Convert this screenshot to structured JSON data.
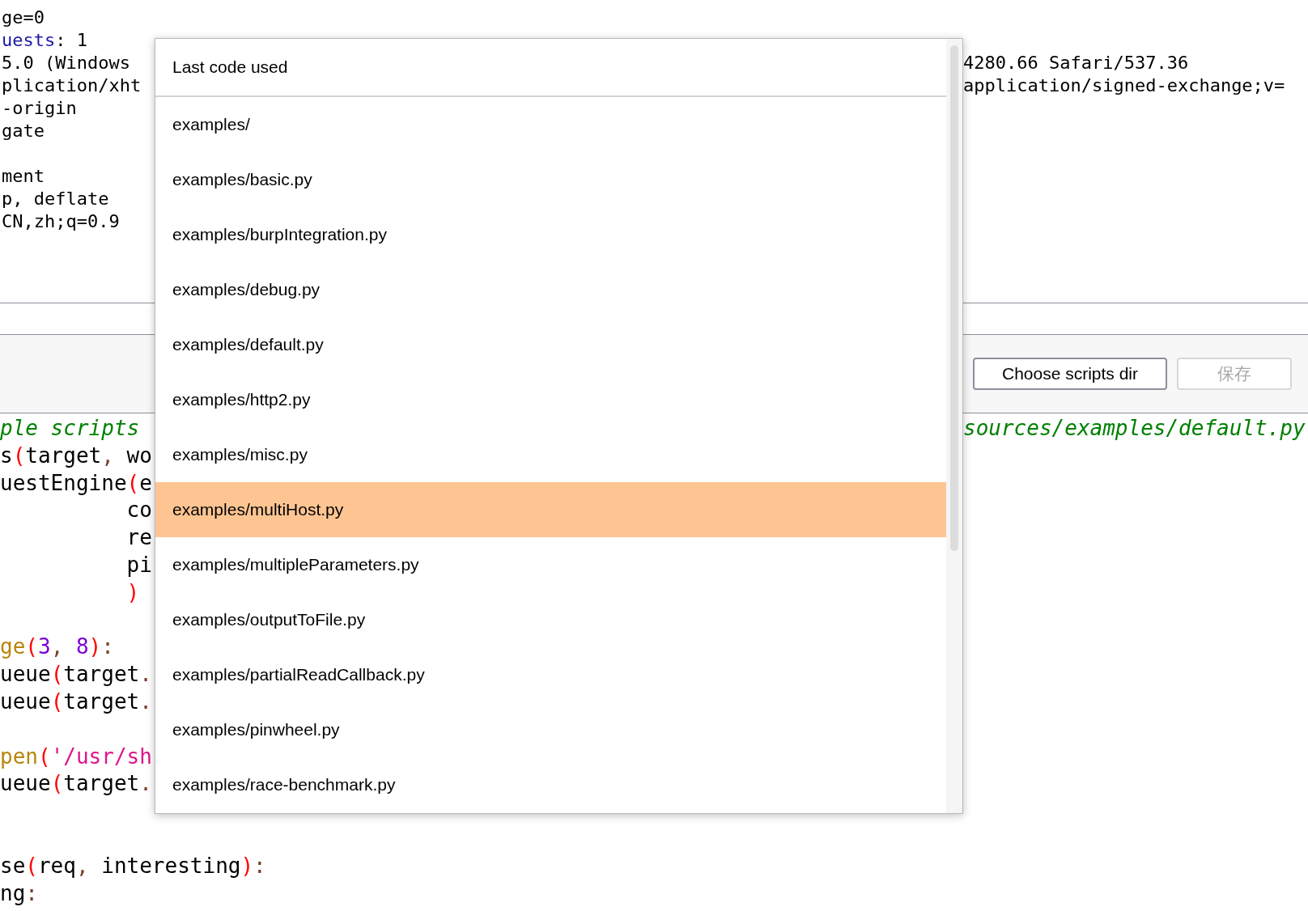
{
  "request_blocks": [
    {
      "lines": [
        {
          "tokens": [
            {
              "text": "ge=0",
              "color": "#000000"
            }
          ]
        },
        {
          "tokens": [
            {
              "text": "uests",
              "color": "#1a1aa6"
            },
            {
              "text": ": 1",
              "color": "#000000"
            }
          ]
        },
        {
          "tokens": [
            {
              "text": "5.0 (Windows",
              "color": "#000000"
            }
          ],
          "right": "4280.66 Safari/537.36"
        },
        {
          "tokens": [
            {
              "text": "plication/xht",
              "color": "#000000"
            }
          ],
          "right": "application/signed-exchange;v="
        },
        {
          "tokens": [
            {
              "text": "-origin",
              "color": "#000000"
            }
          ]
        },
        {
          "tokens": [
            {
              "text": "gate",
              "color": "#000000"
            }
          ]
        }
      ]
    },
    {
      "lines": [
        {
          "tokens": [
            {
              "text": "ment",
              "color": "#000000"
            }
          ]
        },
        {
          "tokens": [
            {
              "text": "p, deflate",
              "color": "#000000"
            }
          ]
        },
        {
          "tokens": [
            {
              "text": "CN,zh;q=0.9",
              "color": "#000000"
            }
          ]
        }
      ]
    }
  ],
  "toolbar": {
    "buttons": [
      {
        "label": "Choose scripts dir",
        "disabled": false
      },
      {
        "label": "保存",
        "disabled": true
      }
    ]
  },
  "code_blocks": [
    {
      "lines": [
        {
          "kind": "comment",
          "tokens": [
            {
              "text": "ple scripts",
              "color": "#008000"
            }
          ],
          "right": "sources/examples/default.py"
        },
        {
          "kind": "code",
          "tokens": [
            {
              "text": "s",
              "color": "#000000"
            },
            {
              "text": "(",
              "color": "#ff0000"
            },
            {
              "text": "target",
              "color": "#000000"
            },
            {
              "text": ",",
              "color": "#7a3e2e"
            },
            {
              "text": " wo",
              "color": "#000000"
            }
          ]
        },
        {
          "kind": "code",
          "tokens": [
            {
              "text": "uestEngine",
              "color": "#000000"
            },
            {
              "text": "(",
              "color": "#ff0000"
            },
            {
              "text": "e",
              "color": "#000000"
            }
          ]
        },
        {
          "kind": "code",
          "tokens": [
            {
              "text": "          co",
              "color": "#000000"
            }
          ]
        },
        {
          "kind": "code",
          "tokens": [
            {
              "text": "          re",
              "color": "#000000"
            }
          ]
        },
        {
          "kind": "code",
          "tokens": [
            {
              "text": "          pi",
              "color": "#000000"
            }
          ]
        },
        {
          "kind": "code",
          "tokens": [
            {
              "text": "          )",
              "color": "#ff0000"
            }
          ]
        }
      ]
    },
    {
      "lines": [
        {
          "kind": "code",
          "tokens": [
            {
              "text": "ge",
              "color": "#b8860b"
            },
            {
              "text": "(",
              "color": "#ff0000"
            },
            {
              "text": "3",
              "color": "#7b00d6"
            },
            {
              "text": ", ",
              "color": "#7a3e2e"
            },
            {
              "text": "8",
              "color": "#7b00d6"
            },
            {
              "text": ")",
              "color": "#ff0000"
            },
            {
              "text": ":",
              "color": "#7a3e2e"
            }
          ]
        },
        {
          "kind": "code",
          "tokens": [
            {
              "text": "ueue",
              "color": "#000000"
            },
            {
              "text": "(",
              "color": "#ff0000"
            },
            {
              "text": "target",
              "color": "#000000"
            },
            {
              "text": ".",
              "color": "#7a3e2e"
            }
          ]
        },
        {
          "kind": "code",
          "tokens": [
            {
              "text": "ueue",
              "color": "#000000"
            },
            {
              "text": "(",
              "color": "#ff0000"
            },
            {
              "text": "target",
              "color": "#000000"
            },
            {
              "text": ".",
              "color": "#7a3e2e"
            }
          ]
        }
      ]
    },
    {
      "lines": [
        {
          "kind": "code",
          "tokens": [
            {
              "text": "pen",
              "color": "#b8860b"
            },
            {
              "text": "(",
              "color": "#ff0000"
            },
            {
              "text": "'/usr/sh",
              "color": "#e0158a"
            }
          ]
        },
        {
          "kind": "code",
          "tokens": [
            {
              "text": "ueue",
              "color": "#000000"
            },
            {
              "text": "(",
              "color": "#ff0000"
            },
            {
              "text": "target",
              "color": "#000000"
            },
            {
              "text": ".",
              "color": "#7a3e2e"
            }
          ]
        }
      ]
    },
    {
      "lines": [
        {
          "kind": "code",
          "tokens": [
            {
              "text": "se",
              "color": "#000000"
            },
            {
              "text": "(",
              "color": "#ff0000"
            },
            {
              "text": "req",
              "color": "#000000"
            },
            {
              "text": ", ",
              "color": "#7a3e2e"
            },
            {
              "text": "interesting",
              "color": "#000000"
            },
            {
              "text": ")",
              "color": "#ff0000"
            },
            {
              "text": ":",
              "color": "#7a3e2e"
            }
          ]
        },
        {
          "kind": "code",
          "tokens": [
            {
              "text": "ng",
              "color": "#000000"
            },
            {
              "text": ":",
              "color": "#7a3e2e"
            }
          ]
        }
      ]
    }
  ],
  "dropdown": {
    "header": "Last code used",
    "items": [
      {
        "label": "examples/",
        "selected": false
      },
      {
        "label": "examples/basic.py",
        "selected": false
      },
      {
        "label": "examples/burpIntegration.py",
        "selected": false
      },
      {
        "label": "examples/debug.py",
        "selected": false
      },
      {
        "label": "examples/default.py",
        "selected": false
      },
      {
        "label": "examples/http2.py",
        "selected": false
      },
      {
        "label": "examples/misc.py",
        "selected": false
      },
      {
        "label": "examples/multiHost.py",
        "selected": true
      },
      {
        "label": "examples/multipleParameters.py",
        "selected": false
      },
      {
        "label": "examples/outputToFile.py",
        "selected": false
      },
      {
        "label": "examples/partialReadCallback.py",
        "selected": false
      },
      {
        "label": "examples/pinwheel.py",
        "selected": false
      },
      {
        "label": "examples/race-benchmark.py",
        "selected": false
      }
    ]
  }
}
